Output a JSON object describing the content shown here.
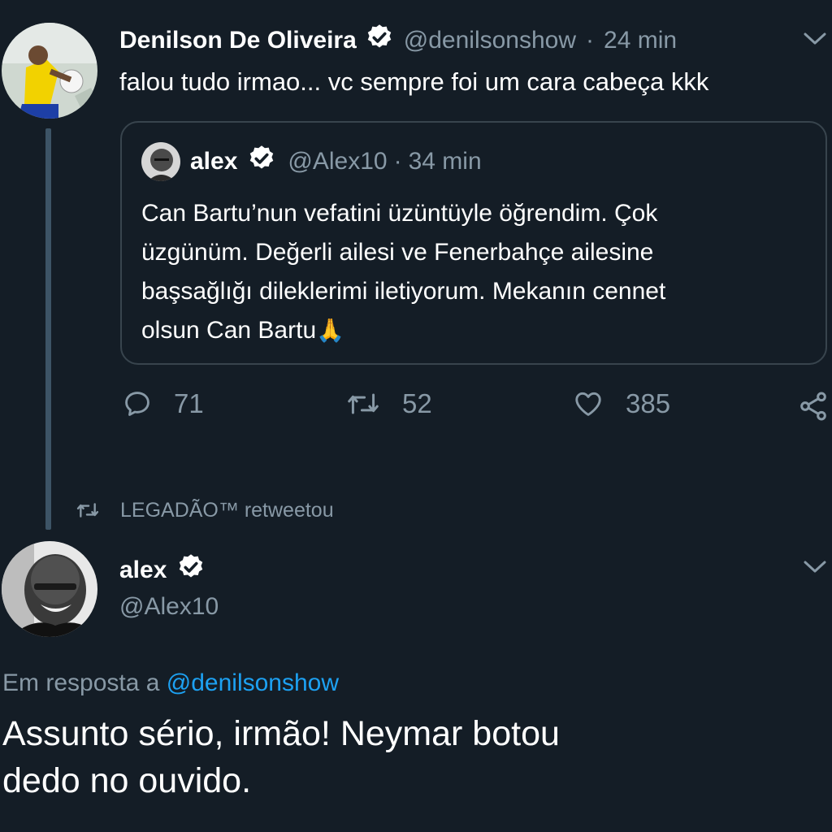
{
  "tweet1": {
    "author_name": "Denilson De Oliveira",
    "handle": "@denilsonshow",
    "separator": "·",
    "time": "24 min",
    "text": "falou tudo irmao... vc sempre foi um cara cabeça kkk"
  },
  "quoted": {
    "author_name": "alex",
    "handle": "@Alex10",
    "separator": "·",
    "time": "34 min",
    "lines": [
      "Can Bartu’nun vefatini üzüntüyle öğrendim. Çok",
      "üzgünüm. Değerli ailesi ve Fenerbahçe ailesine",
      "başsağlığı dileklerimi iletiyorum. Mekanın cennet",
      "olsun Can Bartu"
    ],
    "emoji": "🙏"
  },
  "actions": {
    "replies": "71",
    "retweets": "52",
    "likes": "385"
  },
  "retweet_context": {
    "text": "LEGADÃO™ retweetou"
  },
  "tweet2": {
    "author_name": "alex",
    "handle": "@Alex10",
    "reply_prefix": "Em resposta a",
    "reply_to": "@denilsonshow",
    "lines": [
      "Assunto sério, irmão! Neymar botou",
      "dedo no ouvido."
    ]
  },
  "colors": {
    "background": "#141d26",
    "muted": "#8899a6",
    "link": "#1da1f2",
    "border": "#38444d"
  }
}
